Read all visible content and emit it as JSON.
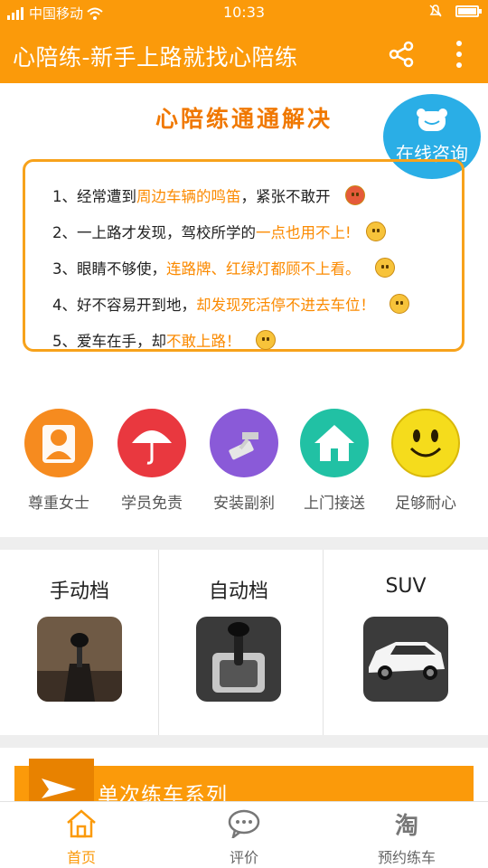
{
  "status_bar": {
    "carrier": "中国移动",
    "time": "10:33"
  },
  "app_bar": {
    "title": "心陪练-新手上路就找心陪练",
    "share_icon": "share-icon",
    "more_icon": "more-vertical-icon"
  },
  "hero": {
    "headline": "心陪练通通解决",
    "consult_label": "在线咨询",
    "problems": [
      {
        "prefix": "1、经常遭到",
        "highlight": "周边车辆的鸣笛",
        "suffix": "，紧张不敢开",
        "emoji": "angry"
      },
      {
        "prefix": "2、一上路才发现，驾校所学的",
        "highlight": "一点也用不上!",
        "suffix": "",
        "emoji": "dizzy"
      },
      {
        "prefix": "3、眼睛不够使，",
        "highlight": "连路牌、红绿灯都顾不上看。",
        "suffix": "",
        "emoji": "crying"
      },
      {
        "prefix": "4、好不容易开到地，",
        "highlight": "却发现死活停不进去车位！",
        "suffix": "",
        "emoji": "frustrated"
      },
      {
        "prefix": "5、爱车在手，却",
        "highlight": "不敢上路！",
        "suffix": "",
        "emoji": "scared"
      }
    ]
  },
  "features": [
    {
      "label": "尊重女士",
      "color": "#f68b1f",
      "icon": "woman-icon"
    },
    {
      "label": "学员免责",
      "color": "#e9383f",
      "icon": "umbrella-icon"
    },
    {
      "label": "安装副刹",
      "color": "#8a5ad8",
      "icon": "brake-pedal-icon"
    },
    {
      "label": "上门接送",
      "color": "#21c1a4",
      "icon": "house-icon"
    },
    {
      "label": "足够耐心",
      "color": "#f5dc1c",
      "icon": "smiley-icon"
    }
  ],
  "car_types": [
    {
      "name": "手动档",
      "image": "manual-gearshift-image"
    },
    {
      "name": "自动档",
      "image": "automatic-gearshift-image"
    },
    {
      "name": "SUV",
      "image": "suv-car-image"
    }
  ],
  "section_banner": {
    "label": "单次练车系列"
  },
  "bottom_nav": [
    {
      "label": "首页",
      "icon": "home-icon",
      "active": true
    },
    {
      "label": "评价",
      "icon": "chat-bubble-icon",
      "active": false
    },
    {
      "label": "预约练车",
      "icon": "taobao-icon",
      "active": false
    }
  ],
  "colors": {
    "brand": "#fb9a0a",
    "highlight": "#fb8a00",
    "consult": "#2aaee6"
  }
}
